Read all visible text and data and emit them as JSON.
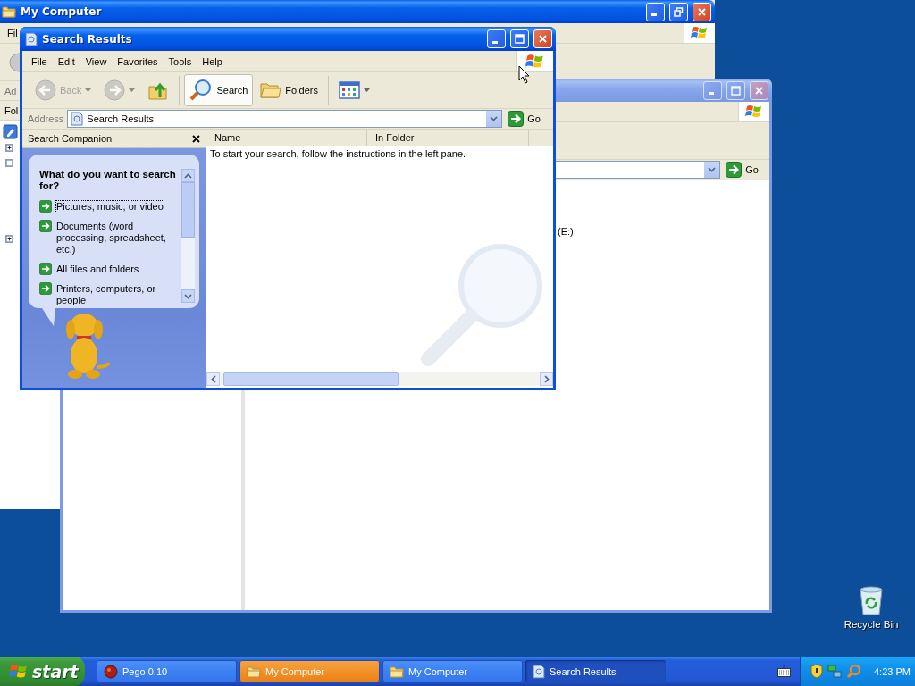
{
  "back_window": {
    "title": "My Computer",
    "active": true,
    "menu_label": "Fil",
    "address_label": "Ad",
    "pane_label": "Fol",
    "tree": [
      {
        "expanded": false
      },
      {
        "expanded": true
      },
      {
        "expanded": false
      }
    ]
  },
  "middle_window": {
    "active": false,
    "go_label": "Go",
    "drive_label": "(E:)"
  },
  "search_window": {
    "title": "Search Results",
    "active": true,
    "menu": [
      "File",
      "Edit",
      "View",
      "Favorites",
      "Tools",
      "Help"
    ],
    "toolbar": [
      {
        "kind": "back",
        "label": "Back",
        "disabled": true,
        "selected": false
      },
      {
        "kind": "forward",
        "disabled": true,
        "selected": false
      },
      {
        "kind": "up",
        "disabled": false,
        "selected": false
      },
      {
        "kind": "search",
        "label": "Search",
        "disabled": false,
        "selected": true
      },
      {
        "kind": "folders",
        "label": "Folders",
        "disabled": false,
        "selected": false
      },
      {
        "kind": "views",
        "disabled": false,
        "selected": false
      }
    ],
    "address": {
      "label": "Address",
      "value": "Search Results",
      "go_label": "Go"
    },
    "companion": {
      "title": "Search Companion",
      "question": "What do you want to search for?",
      "options": [
        {
          "label": "Pictures, music, or video",
          "focused": true
        },
        {
          "label": "Documents (word processing, spreadsheet, etc.)",
          "focused": false
        },
        {
          "label": "All files and folders",
          "focused": false
        },
        {
          "label": "Printers, computers, or people",
          "focused": false
        }
      ]
    },
    "columns": [
      "Name",
      "In Folder"
    ],
    "message": "To start your search, follow the instructions in the left pane."
  },
  "desktop_icons": [
    {
      "label": "Recycle Bin"
    }
  ],
  "taskbar": {
    "start_label": "start",
    "tasks": [
      {
        "label": "Pego 0.10",
        "kind": "app",
        "selected": false,
        "flashing": false
      },
      {
        "label": "My Computer",
        "kind": "folder",
        "selected": false,
        "flashing": true
      },
      {
        "label": "My Computer",
        "kind": "folder",
        "selected": false,
        "flashing": false
      },
      {
        "label": "Search Results",
        "kind": "search",
        "selected": true,
        "flashing": false
      }
    ],
    "clock": "4:23 PM"
  }
}
